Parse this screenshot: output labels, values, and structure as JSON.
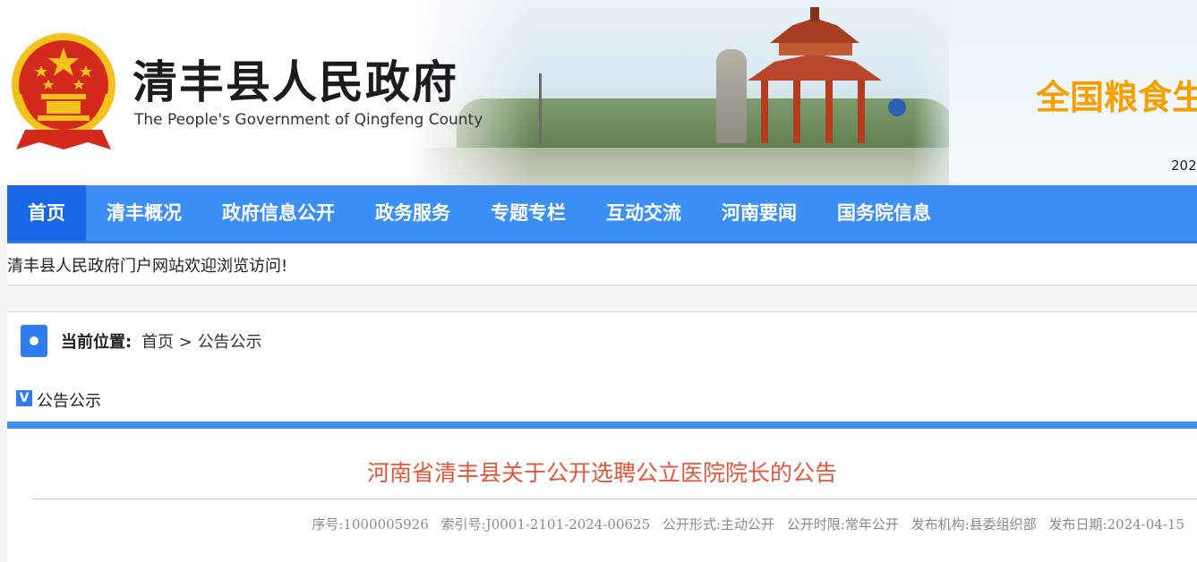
{
  "header": {
    "site_title": "清丰县人民政府",
    "site_subtitle": "The People's Government of Qingfeng County",
    "slogan": "全国粮食生",
    "date_fragment": "202"
  },
  "nav": {
    "items": [
      "首页",
      "清丰概况",
      "政府信息公开",
      "政务服务",
      "专题专栏",
      "互动交流",
      "河南要闻",
      "国务院信息"
    ]
  },
  "welcome": "清丰县人民政府门户网站欢迎浏览访问!",
  "breadcrumb": {
    "label": "当前位置:",
    "home": "首页",
    "separator": ">",
    "current": "公告公示"
  },
  "column": {
    "badge": "V",
    "label": "公告公示"
  },
  "article": {
    "title": "河南省清丰县关于公开选聘公立医院院长的公告",
    "meta": {
      "serial": "序号:1000005926",
      "index": "索引号:J0001-2101-2024-00625",
      "form": "公开形式:主动公开",
      "term": "公开时限:常年公开",
      "org": "发布机构:县委组织部",
      "date": "发布日期:2024-04-15"
    }
  },
  "colors": {
    "nav_blue": "#3b8ff5",
    "nav_active": "#1866e6",
    "title_red": "#e5553a",
    "slogan_orange": "#f5a000",
    "emblem_red": "#d42a1e",
    "emblem_gold": "#f3c21b"
  },
  "icons": [
    "national-emblem-icon",
    "location-dot-icon"
  ]
}
